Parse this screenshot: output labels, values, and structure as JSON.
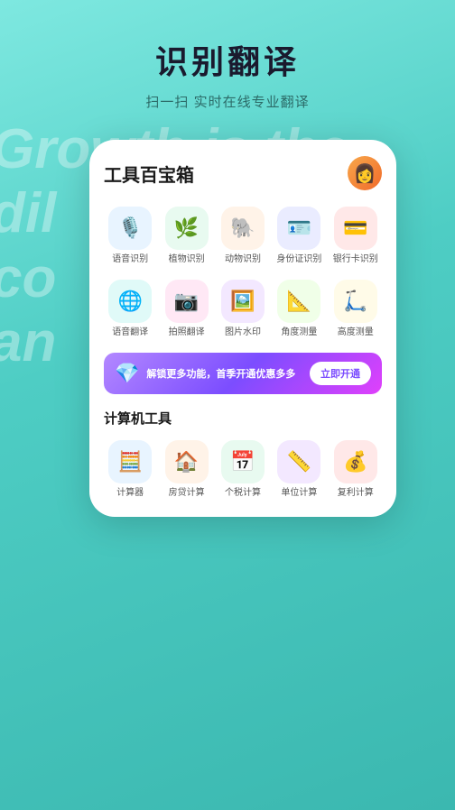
{
  "page": {
    "background_color": "#4ecdc4"
  },
  "header": {
    "main_title": "识别翻译",
    "sub_title": "扫一扫 实时在线专业翻译"
  },
  "bg_text": {
    "line1": "Growth is the",
    "line2": "dil",
    "line3": "co",
    "line4": "an"
  },
  "card": {
    "title": "工具百宝箱",
    "avatar_emoji": "👩"
  },
  "tools_row1": [
    {
      "id": "voice-recog",
      "label": "语音识别",
      "emoji": "🎙️",
      "bg": "icon-blue"
    },
    {
      "id": "plant-recog",
      "label": "植物识别",
      "emoji": "🌿",
      "bg": "icon-green"
    },
    {
      "id": "animal-recog",
      "label": "动物识别",
      "emoji": "🐘",
      "bg": "icon-orange"
    },
    {
      "id": "id-recog",
      "label": "身份证识别",
      "emoji": "🪪",
      "bg": "icon-indigo"
    },
    {
      "id": "bank-recog",
      "label": "银行卡识别",
      "emoji": "💳",
      "bg": "icon-red"
    }
  ],
  "tools_row2": [
    {
      "id": "voice-translate",
      "label": "语音翻译",
      "emoji": "🌐",
      "bg": "icon-teal"
    },
    {
      "id": "photo-translate",
      "label": "拍照翻译",
      "emoji": "📷",
      "bg": "icon-pink"
    },
    {
      "id": "img-watermark",
      "label": "图片水印",
      "emoji": "🖼️",
      "bg": "icon-purple"
    },
    {
      "id": "angle-measure",
      "label": "角度测量",
      "emoji": "📐",
      "bg": "icon-lime"
    },
    {
      "id": "height-measure",
      "label": "高度测量",
      "emoji": "🛴",
      "bg": "icon-yellow"
    }
  ],
  "banner": {
    "gem_emoji": "💎",
    "text": "解锁更多功能，首季开通优惠多多",
    "button_label": "立即开通"
  },
  "calc_section": {
    "title": "计算机工具",
    "items": [
      {
        "id": "calculator",
        "label": "计算器",
        "emoji": "🧮",
        "bg": "icon-blue"
      },
      {
        "id": "mortgage-calc",
        "label": "房贷计算",
        "emoji": "🏠",
        "bg": "icon-orange"
      },
      {
        "id": "tax-calc",
        "label": "个税计算",
        "emoji": "📅",
        "bg": "icon-green"
      },
      {
        "id": "unit-calc",
        "label": "单位计算",
        "emoji": "📏",
        "bg": "icon-purple"
      },
      {
        "id": "compound-calc",
        "label": "复利计算",
        "emoji": "💰",
        "bg": "icon-red"
      }
    ]
  }
}
